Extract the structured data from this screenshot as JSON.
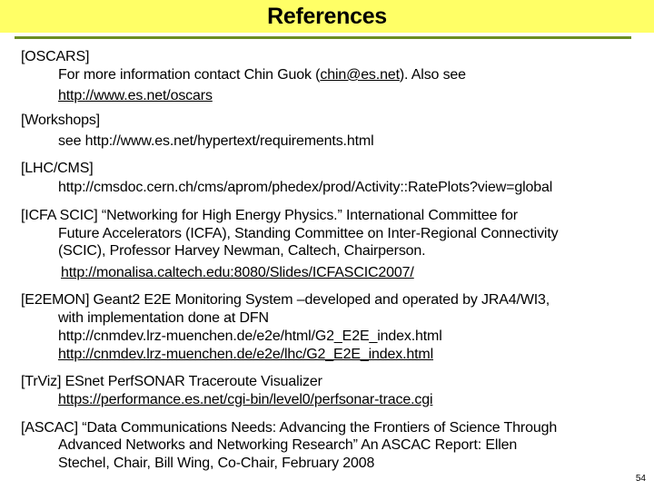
{
  "slide": {
    "title": "References",
    "page_number": "54",
    "colors": {
      "title_band": "#ffff66",
      "rule": "#6b8e23"
    }
  },
  "refs": {
    "oscars": {
      "tag": "[OSCARS]",
      "line1_pre": "For more information contact Chin Guok (",
      "email": "chin@es.net",
      "line1_post": "). Also see",
      "url": "http://www.es.net/oscars"
    },
    "workshops": {
      "tag": "[Workshops]",
      "line1": "see http://www.es.net/hypertext/requirements.html"
    },
    "lhc": {
      "tag": "[LHC/CMS]",
      "url": "http://cmsdoc.cern.ch/cms/aprom/phedex/prod/Activity::RatePlots?view=global"
    },
    "icfa": {
      "line1": "[ICFA SCIC]  “Networking for High Energy Physics.” International Committee for",
      "line2": "Future Accelerators (ICFA), Standing Committee on Inter-Regional Connectivity",
      "line3": "(SCIC), Professor Harvey Newman, Caltech, Chairperson.",
      "url": "http://monalisa.caltech.edu:8080/Slides/ICFASCIC2007/"
    },
    "e2emon": {
      "line1": "[E2EMON]   Geant2 E2E Monitoring System –developed and operated by JRA4/WI3,",
      "line2": "with implementation done at DFN",
      "url1": "http://cnmdev.lrz-muenchen.de/e2e/html/G2_E2E_index.html",
      "url2": "http://cnmdev.lrz-muenchen.de/e2e/lhc/G2_E2E_index.html"
    },
    "trviz": {
      "line1": "[TrViz]   ESnet PerfSONAR Traceroute Visualizer",
      "url": "https://performance.es.net/cgi-bin/level0/perfsonar-trace.cgi"
    },
    "ascac": {
      "line1": "[ASCAC] “Data Communications Needs: Advancing the Frontiers of Science Through",
      "line2": "Advanced Networks and Networking Research” An ASCAC Report: Ellen",
      "line3": "Stechel, Chair, Bill Wing, Co-Chair, February 2008"
    }
  }
}
